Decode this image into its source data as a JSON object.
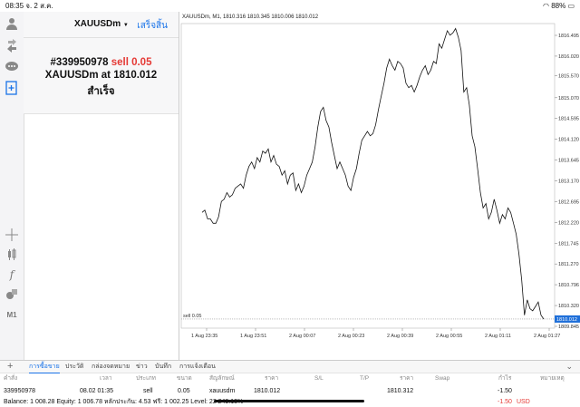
{
  "status": {
    "time": "08:35",
    "date": "จ. 2 ส.ค.",
    "battery": "88%"
  },
  "panel": {
    "symbol": "XAUUSDm",
    "done_label": "เสร็จสิ้น",
    "order_id": "#339950978",
    "order_side": "sell 0.05",
    "order_symbol_at": "XAUUSDm at",
    "order_price": "1810.012",
    "order_status": "สำเร็จ"
  },
  "chart_header": "XAUUSDm, M1, 1810.316 1810.345 1810.006 1810.012",
  "chart_data": {
    "type": "line",
    "title": "XAUUSDm, M1, 1810.316 1810.345 1810.006 1810.012",
    "x_labels": [
      "1 Aug 23:35",
      "1 Aug 23:51",
      "2 Aug 00:07",
      "2 Aug 00:23",
      "2 Aug 00:39",
      "2 Aug 00:55",
      "2 Aug 01:11",
      "2 Aug 01:27"
    ],
    "y_ticks": [
      "1816.495",
      "1816.020",
      "1815.570",
      "1815.070",
      "1814.595",
      "1814.120",
      "1813.645",
      "1813.170",
      "1812.695",
      "1812.220",
      "1811.745",
      "1811.270",
      "1810.796",
      "1810.320",
      "1809.845"
    ],
    "ylim": [
      1809.845,
      1816.495
    ],
    "current_price": "1810.012",
    "sell_line": {
      "label": "sell 0.05",
      "price": 1810.012
    },
    "series": [
      {
        "values": [
          1812.45,
          1812.5,
          1812.3,
          1812.3,
          1812.2,
          1812.2,
          1812.35,
          1812.7,
          1812.75,
          1812.9,
          1812.8,
          1812.85,
          1813.0,
          1813.05,
          1813.1,
          1813.0,
          1813.3,
          1813.5,
          1813.6,
          1813.45,
          1813.7,
          1813.6,
          1813.85,
          1813.8,
          1813.9,
          1813.6,
          1813.75,
          1813.55,
          1813.5,
          1813.3,
          1813.4,
          1813.1,
          1813.3,
          1813.35,
          1812.95,
          1813.1,
          1812.9,
          1813.05,
          1813.3,
          1813.45,
          1813.6,
          1813.95,
          1814.4,
          1814.75,
          1814.85,
          1814.55,
          1814.4,
          1814.05,
          1813.75,
          1813.45,
          1813.6,
          1813.45,
          1813.3,
          1813.05,
          1812.95,
          1813.25,
          1813.45,
          1813.8,
          1814.1,
          1814.2,
          1814.3,
          1814.2,
          1814.25,
          1814.45,
          1814.8,
          1815.1,
          1815.4,
          1815.75,
          1815.95,
          1815.8,
          1815.7,
          1815.9,
          1815.85,
          1815.75,
          1815.4,
          1815.3,
          1815.35,
          1815.2,
          1815.35,
          1815.55,
          1815.7,
          1815.8,
          1815.6,
          1815.7,
          1815.9,
          1815.85,
          1816.3,
          1816.2,
          1816.4,
          1816.6,
          1816.5,
          1816.55,
          1816.65,
          1816.45,
          1816.15,
          1815.2,
          1815.3,
          1814.9,
          1814.2,
          1813.95,
          1813.45,
          1812.9,
          1812.55,
          1812.65,
          1812.3,
          1812.45,
          1812.75,
          1812.5,
          1812.2,
          1812.4,
          1812.3,
          1812.55,
          1812.45,
          1812.2,
          1811.95,
          1811.5,
          1810.9,
          1810.1,
          1810.45,
          1810.25,
          1810.2,
          1810.3,
          1810.4,
          1810.1,
          1810.01
        ]
      }
    ]
  },
  "tabs": [
    "การซื้อขาย",
    "ประวัติ",
    "กล่องจดหมาย",
    "ข่าว",
    "บันทึก",
    "การแจ้งเตือน"
  ],
  "table": {
    "headers": [
      "คำสั่ง",
      "เวลา",
      "ประเภท",
      "ขนาด",
      "สัญลักษณ์",
      "ราคา",
      "S/L",
      "T/P",
      "ราคา",
      "Swap",
      "กำไร",
      "หมายเหตุ"
    ],
    "row": [
      "339950978",
      "08.02 01:35",
      "sell",
      "0.05",
      "xauusdm",
      "1810.012",
      "",
      "",
      "1810.312",
      "",
      "-1.50",
      ""
    ]
  },
  "balance": {
    "text": "Balance: 1 008.28 Equity: 1 006.78 หลักประกัน: 4.53 ฟรี: 1 002.25 Level: 22 249.13%",
    "profit": "-1.50",
    "currency": "USD"
  },
  "colors": {
    "accent": "#1a73e8",
    "sell": "#e53935",
    "current_price_bg": "#1e6fd9"
  }
}
